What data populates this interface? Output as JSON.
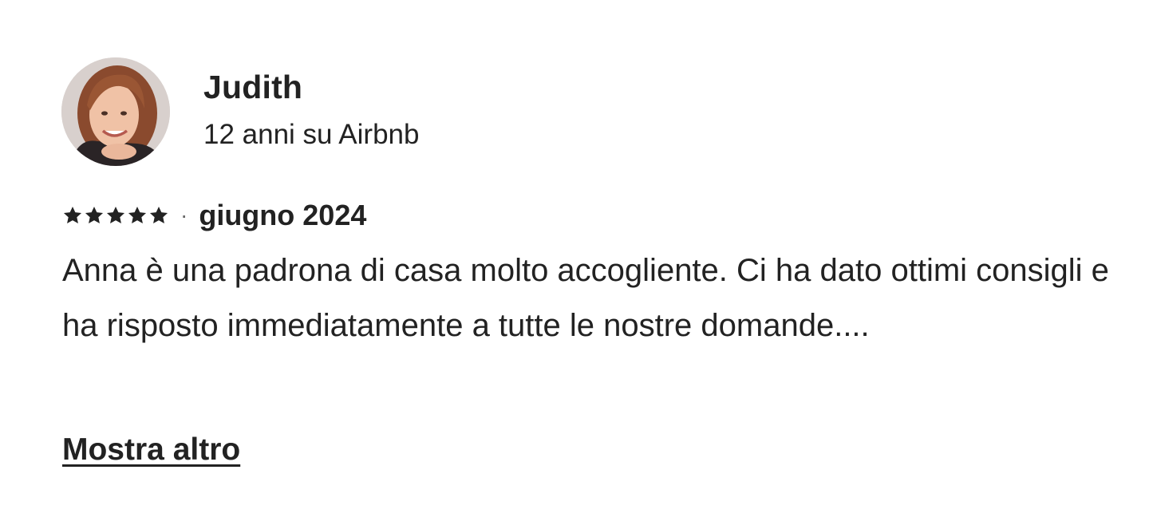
{
  "reviewer": {
    "name": "Judith",
    "meta": "12 anni su Airbnb",
    "avatar_icon": "reviewer-avatar-photo"
  },
  "review": {
    "rating": 5,
    "rating_max": 5,
    "separator": "·",
    "date": "giugno 2024",
    "text": "Anna è una padrona di casa molto accogliente. Ci ha dato ottimi consigli e ha risposto immediatamente a tutte le nostre domande....",
    "show_more_label": "Mostra altro"
  },
  "colors": {
    "text": "#222222",
    "star": "#222222",
    "separator": "#6a6a6a"
  }
}
